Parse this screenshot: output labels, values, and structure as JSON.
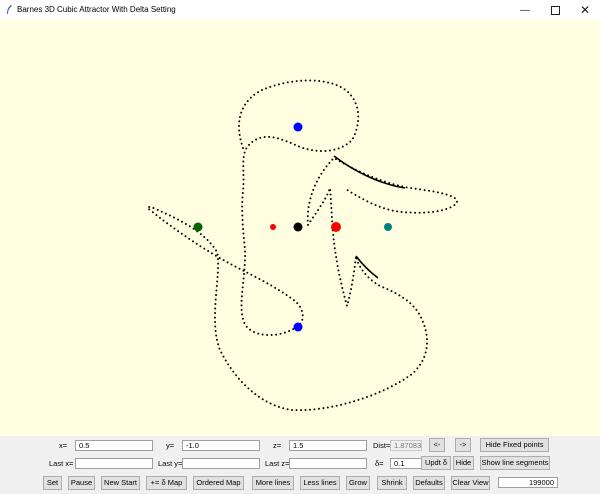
{
  "window": {
    "title": "Barnes 3D Cubic Attractor With Delta Setting",
    "minimize_icon": "minimize-icon",
    "maximize_icon": "maximize-icon",
    "close_icon": "close-icon"
  },
  "canvas": {
    "background": "#fffee0",
    "curve_color": "#000000",
    "markers": [
      {
        "name": "fixed-point-blue-top",
        "color": "#0000ff"
      },
      {
        "name": "fixed-point-blue-bottom",
        "color": "#0000ff"
      },
      {
        "name": "fixed-point-green",
        "color": "#006400"
      },
      {
        "name": "fixed-point-red-small",
        "color": "#ff0000"
      },
      {
        "name": "fixed-point-black",
        "color": "#000000"
      },
      {
        "name": "fixed-point-red-large",
        "color": "#ff0000"
      },
      {
        "name": "fixed-point-teal",
        "color": "#008080"
      }
    ]
  },
  "controls": {
    "x_label": "x=",
    "x_value": "0.5",
    "y_label": "y=",
    "y_value": "-1.0",
    "z_label": "z=",
    "z_value": "1.5",
    "dist_label": "Dist=",
    "dist_value": "1.87083",
    "prev_label": "<-",
    "next_label": "->",
    "hide_fixed_label": "Hide Fixed points",
    "last_x_label": "Last x=",
    "last_x_value": "",
    "last_y_label": "Last y=",
    "last_y_value": "",
    "last_z_label": "Last z=",
    "last_z_value": "",
    "delta_label": "δ=",
    "delta_value": "0.1",
    "updt_delta_label": "Updt δ",
    "hide_label": "Hide",
    "show_segments_label": "Show line segments",
    "set_label": "Set",
    "pause_label": "Pause",
    "new_start_label": "New Start",
    "delta_map_label": "+= δ Map",
    "ordered_map_label": "Ordered Map",
    "more_lines_label": "More lines",
    "less_lines_label": "Less lines",
    "grow_label": "Grow",
    "shrink_label": "Shrink",
    "defaults_label": "Defaults",
    "clear_view_label": "Clear View",
    "count_value": "199000"
  }
}
